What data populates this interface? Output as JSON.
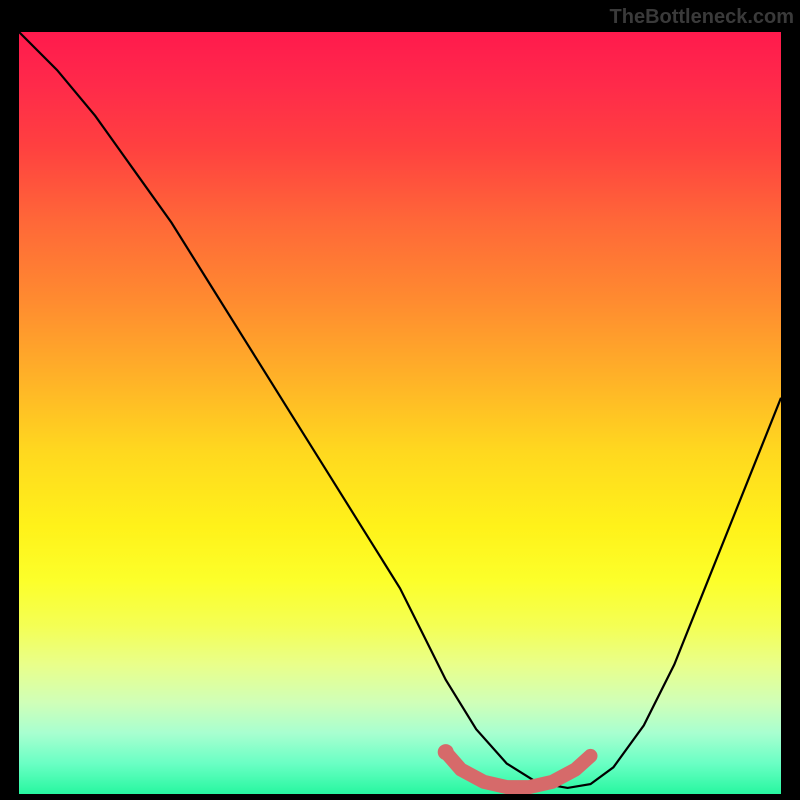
{
  "watermark": "TheBottleneck.com",
  "chart_data": {
    "type": "line",
    "title": "",
    "xlabel": "",
    "ylabel": "",
    "xlim": [
      0,
      100
    ],
    "ylim": [
      0,
      100
    ],
    "series": [
      {
        "name": "bottleneck-curve",
        "x": [
          0,
          5,
          10,
          15,
          20,
          25,
          30,
          35,
          40,
          45,
          50,
          53,
          56,
          60,
          64,
          68,
          72,
          75,
          78,
          82,
          86,
          90,
          94,
          98,
          100
        ],
        "y": [
          100,
          95,
          89,
          82,
          75,
          67,
          59,
          51,
          43,
          35,
          27,
          21,
          15,
          8.5,
          4.0,
          1.5,
          0.8,
          1.3,
          3.5,
          9,
          17,
          27,
          37,
          47,
          52
        ]
      }
    ],
    "highlight": {
      "name": "optimal-range",
      "color": "#d66a6a",
      "x": [
        56,
        58,
        61,
        64,
        67,
        70,
        73,
        75
      ],
      "y": [
        5.5,
        3.2,
        1.6,
        0.9,
        0.9,
        1.6,
        3.2,
        5.0
      ]
    }
  }
}
